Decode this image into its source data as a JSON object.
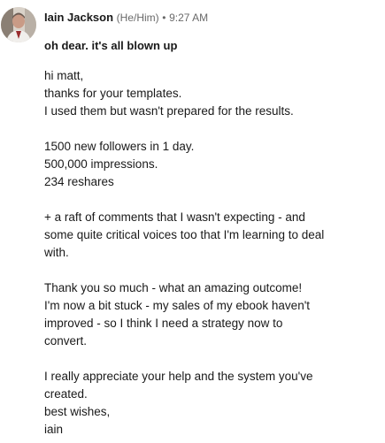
{
  "message": {
    "sender": {
      "name": "Iain Jackson",
      "pronouns": "(He/Him)",
      "separator": "•",
      "time": "9:27 AM",
      "avatar_icon": "profile-photo"
    },
    "subject": "oh dear. it's all blown up",
    "paragraphs": [
      [
        "hi matt,",
        "thanks for your templates.",
        "I used them but wasn't prepared for the results."
      ],
      [
        "1500 new followers in 1 day.",
        "500,000 impressions.",
        "234 reshares"
      ],
      [
        "+ a raft of comments that I wasn't expecting - and",
        "some quite critical voices too that I'm learning to deal",
        "with."
      ],
      [
        "Thank you so much - what an amazing outcome!",
        "I'm now a bit stuck - my sales of my ebook haven't",
        "improved - so I think I need a strategy now to",
        "convert."
      ],
      [
        "I really appreciate your help and the system you've",
        "created.",
        "best wishes,",
        "iain"
      ]
    ]
  }
}
